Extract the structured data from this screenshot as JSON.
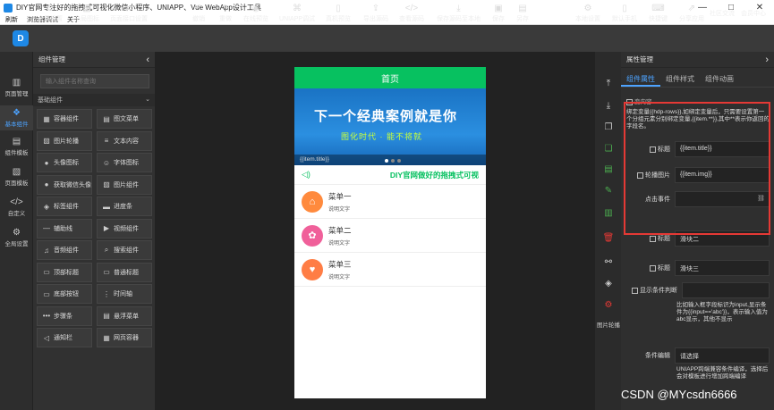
{
  "window": {
    "title": "DIY官网专注好的拖拽式可视化微信小程序、UNIAPP、Vue WebApp设计工具",
    "min": "—",
    "max": "□",
    "close": "✕"
  },
  "menu": [
    "刷新",
    "浏览器调试",
    "关于"
  ],
  "app_logo": "D",
  "toolbar": {
    "left": [
      {
        "label": "全局设置",
        "icon": "gear-icon",
        "glyph": "⚙"
      },
      {
        "label": "全局图标",
        "icon": "grid-icon",
        "glyph": "▦"
      },
      {
        "label": "页面接口设置",
        "icon": "api-icon",
        "glyph": "⇄"
      }
    ],
    "center": [
      {
        "label": "撤销",
        "icon": "undo-icon",
        "glyph": "↶"
      },
      {
        "label": "重做",
        "icon": "redo-icon",
        "glyph": "↷"
      },
      {
        "label": "在线预览",
        "icon": "eye-icon",
        "glyph": "◉"
      },
      {
        "label": "UNIAPP调试",
        "icon": "bug-icon",
        "glyph": "⌘"
      },
      {
        "label": "真机预览",
        "icon": "phone-icon",
        "glyph": "▯"
      },
      {
        "label": "导出源码",
        "icon": "export-icon",
        "glyph": "⇪"
      },
      {
        "label": "查看源码",
        "icon": "code-icon",
        "glyph": "</>"
      },
      {
        "label": "保存源码至本地",
        "icon": "download-icon",
        "glyph": "⤓"
      },
      {
        "label": "保存",
        "icon": "save-icon",
        "glyph": "▣"
      },
      {
        "label": "另存",
        "icon": "save-as-icon",
        "glyph": "▤"
      }
    ],
    "right": [
      {
        "label": "本地设置",
        "icon": "settings-icon",
        "glyph": "⚙"
      },
      {
        "label": "默认手机",
        "icon": "mobile-icon",
        "glyph": "▯"
      },
      {
        "label": "快捷键",
        "icon": "keyboard-icon",
        "glyph": "⌨"
      },
      {
        "label": "分享应用",
        "icon": "share-icon",
        "glyph": "⇗"
      },
      {
        "label": "社区交流",
        "icon": "",
        "glyph": ""
      },
      {
        "label": "会员中心",
        "icon": "",
        "glyph": ""
      }
    ]
  },
  "rail": [
    {
      "label": "页面管理",
      "glyph": "▥",
      "icon": "pages-icon"
    },
    {
      "label": "基本组件",
      "glyph": "❖",
      "icon": "component-icon",
      "active": true
    },
    {
      "label": "组件模板",
      "glyph": "▤",
      "icon": "template-icon"
    },
    {
      "label": "页面模板",
      "glyph": "▧",
      "icon": "page-template-icon"
    },
    {
      "label": "自定义",
      "glyph": "</>",
      "icon": "custom-code-icon"
    },
    {
      "label": "全局设置",
      "glyph": "⚙",
      "icon": "global-settings-icon"
    }
  ],
  "component_panel": {
    "title": "组件管理",
    "collapse": "‹",
    "search_placeholder": "输入组件名称查询",
    "category": "基础组件",
    "category_arrow": "⌄",
    "items": [
      {
        "label": "容器组件",
        "glyph": "▦"
      },
      {
        "label": "图文菜单",
        "glyph": "▤"
      },
      {
        "label": "图片轮播",
        "glyph": "▨"
      },
      {
        "label": "文本内容",
        "glyph": "≡"
      },
      {
        "label": "头像图标",
        "glyph": "●"
      },
      {
        "label": "字体图标",
        "glyph": "☺"
      },
      {
        "label": "获取微信头像",
        "glyph": "●"
      },
      {
        "label": "图片组件",
        "glyph": "▨"
      },
      {
        "label": "标签组件",
        "glyph": "◈"
      },
      {
        "label": "进度条",
        "glyph": "▬"
      },
      {
        "label": "辅助线",
        "glyph": "—"
      },
      {
        "label": "视频组件",
        "glyph": "▶"
      },
      {
        "label": "音频组件",
        "glyph": "♫"
      },
      {
        "label": "搜索组件",
        "glyph": "⌕"
      },
      {
        "label": "顶部标题",
        "glyph": "▭"
      },
      {
        "label": "普通标题",
        "glyph": "▭"
      },
      {
        "label": "底部按钮",
        "glyph": "▭"
      },
      {
        "label": "时间轴",
        "glyph": "⋮"
      },
      {
        "label": "步骤条",
        "glyph": "•••"
      },
      {
        "label": "悬浮菜单",
        "glyph": "▤"
      },
      {
        "label": "通知栏",
        "glyph": "◁"
      },
      {
        "label": "网页容器",
        "glyph": "▦"
      }
    ]
  },
  "phone": {
    "header_title": "首页",
    "banner_text1": "下一个经典案例就是你",
    "banner_text2": "图化时代 · 能不将就",
    "banner_caption": "{{item.title}}",
    "notice_text": "DIY官网做好的拖拽式可视",
    "menu_items": [
      {
        "title": "菜单一",
        "desc": "说明文字",
        "color": "#ff8a3d",
        "glyph": "⌂"
      },
      {
        "title": "菜单二",
        "desc": "说明文字",
        "color": "#f0609a",
        "glyph": "✿"
      },
      {
        "title": "菜单三",
        "desc": "说明文字",
        "color": "#ff7d45",
        "glyph": "♥"
      }
    ]
  },
  "props": {
    "header": "属性管理",
    "collapse": "›",
    "tabs": [
      "组件属性",
      "组件样式",
      "组件动画"
    ],
    "section": "变内容",
    "help": "绑定变量{{hdp-rows}},如绑定变量后，只需要设置第一个分组元素分别绑定变量,{{item.**}},其中**表示你返回的字段名。",
    "fields": [
      {
        "label": "标题",
        "value": "{{item.title}}"
      },
      {
        "label": "轮播图片",
        "value": "{{item.img}}"
      },
      {
        "label": "点击事件",
        "value": ""
      },
      {
        "label": "标题",
        "value": "滑块二"
      },
      {
        "label": "标题",
        "value": "滑块三"
      }
    ],
    "condition_label": "显示条件判断",
    "condition_help": "比如输入框字段标识为input,显示条件为{{input=='abc'}}，表示输入值为abc显示，其他不显示",
    "cond_compile_label": "条件编辑",
    "cond_compile_value": "请选择",
    "cond_compile_help": "UNIAPP跨端兼容条件编译，选择后会对模板进行增加跨端编译",
    "vtool_label": "图片轮播"
  },
  "watermark": "CSDN @MYcsdn6666",
  "colors": {
    "accent": "#4da3ff",
    "green": "#07c160",
    "highlight": "#e53935"
  }
}
